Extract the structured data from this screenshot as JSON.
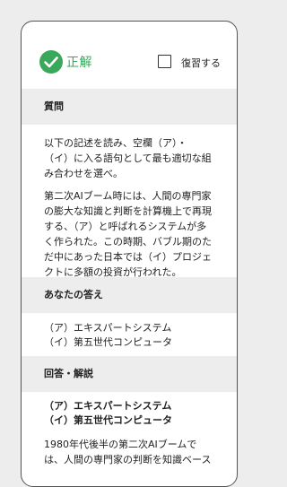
{
  "result": {
    "status_label": "正解",
    "review_label": "復習する",
    "accent_color": "#3aa85b"
  },
  "question": {
    "header": "質問",
    "instruction_lines": [
      "以下の記述を読み、空欄（ア）・",
      "（イ）に入る語句として最も適切な組",
      "み合わせを選べ。"
    ],
    "passage_lines": [
      "第二次AIブーム時には、人間の専門家",
      "の膨大な知識と判断を計算機上で再現",
      "する、（ア）と呼ばれるシステムが多",
      "く作られた。この時期、バブル期のた",
      "だ中にあった日本では（イ）プロジェ",
      "クトに多額の投資が行われた。"
    ]
  },
  "your_answer": {
    "header": "あなたの答え",
    "lines": [
      "（ア）エキスパートシステム",
      "（イ）第五世代コンピュータ"
    ]
  },
  "explanation": {
    "header": "回答・解説",
    "answer_lines": [
      "（ア）エキスパートシステム",
      "（イ）第五世代コンピュータ"
    ],
    "body_lines": [
      "1980年代後半の第二次AIブームで",
      "は、人間の専門家の判断を知識ベース"
    ]
  }
}
